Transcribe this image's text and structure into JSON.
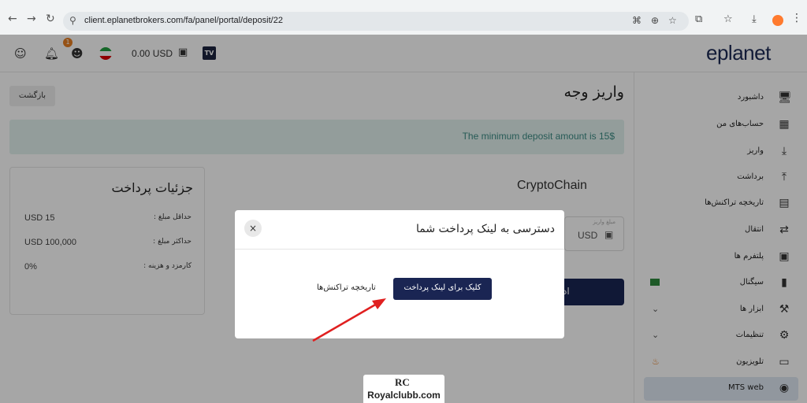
{
  "browser": {
    "url": "client.eplanetbrokers.com/fa/panel/portal/deposit/22",
    "icons": [
      "back-icon",
      "forward-icon",
      "reload-icon",
      "site-info-icon",
      "translate-icon",
      "zoom-icon",
      "star-icon",
      "extensions-icon",
      "bookmarks-icon",
      "download-icon",
      "profile-avatar",
      "menu-icon"
    ]
  },
  "topbar": {
    "notification_count": "1",
    "balance": "0.00 USD",
    "tv_label": "TV",
    "logo": "eplanet"
  },
  "sidebar": {
    "items": [
      {
        "label": "داشبورد",
        "icon": "dashboard-icon",
        "glyph": "🖥"
      },
      {
        "label": "حساب‌های من",
        "icon": "accounts-icon",
        "glyph": "▦"
      },
      {
        "label": "واریز",
        "icon": "deposit-icon",
        "glyph": "⤓"
      },
      {
        "label": "برداشت",
        "icon": "withdraw-icon",
        "glyph": "⤒"
      },
      {
        "label": "تاریخچه تراکنش‌ها",
        "icon": "history-icon",
        "glyph": "▤"
      },
      {
        "label": "انتقال",
        "icon": "transfer-icon",
        "glyph": "⇄"
      },
      {
        "label": "پلتفرم ها",
        "icon": "platforms-icon",
        "glyph": "▣"
      },
      {
        "label": "سیگنال",
        "icon": "signal-icon",
        "glyph": "▮",
        "extra": "new-tag"
      },
      {
        "label": "ابزار ها",
        "icon": "tools-icon",
        "glyph": "⚒",
        "extra": "chevron"
      },
      {
        "label": "تنظیمات",
        "icon": "settings-icon",
        "glyph": "⚙",
        "extra": "chevron"
      },
      {
        "label": "تلویزیون",
        "icon": "tv-icon",
        "glyph": "▭",
        "extra": "fire"
      },
      {
        "label": "MTS web",
        "icon": "mts-icon",
        "glyph": "◉",
        "active": true
      }
    ]
  },
  "main": {
    "back_label": "بازگشت",
    "page_title": "واریز وجه",
    "notice": "The minimum deposit amount is 15$",
    "details": {
      "title": "جزئیات پرداخت",
      "rows": [
        {
          "label": "حداقل مبلغ :",
          "value": "USD 15"
        },
        {
          "label": "حداکثر مبلغ :",
          "value": "USD 100,000"
        },
        {
          "label": "کارمزد و هزینه :",
          "value": "0%"
        }
      ]
    },
    "method_title": "CryptoChain",
    "amount_placeholder": "مبلغ واریز",
    "amount_unit": "USD",
    "submit_label_partial": "اد"
  },
  "modal": {
    "title": "دسترسی به لینک پرداخت شما",
    "close_symbol": "×",
    "pay_button": "کلیک برای لینک پرداخت",
    "history_link": "تاریخچه تراکنش‌ها"
  },
  "watermark": {
    "mark": "RC",
    "text": "Royalclubb.com"
  },
  "colors": {
    "brand_navy": "#1a2553",
    "notice_bg": "#e2f1ef",
    "notice_text": "#3d8c85",
    "active_item_bg": "#dfe8f3",
    "annotation_arrow": "#e02020"
  }
}
